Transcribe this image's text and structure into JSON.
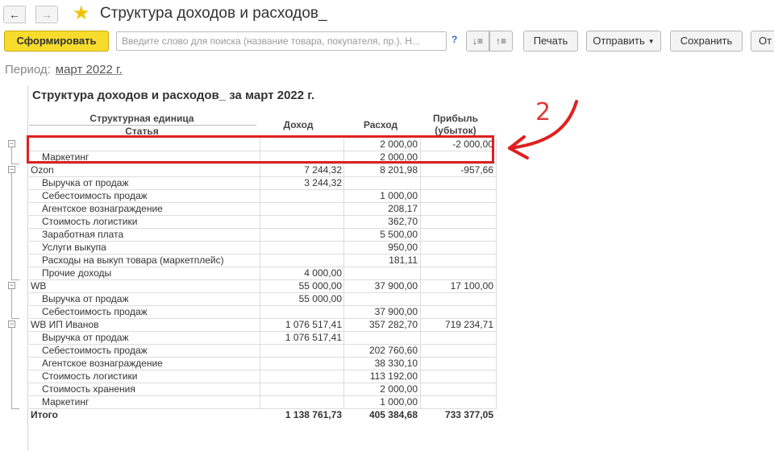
{
  "window": {
    "title": "Структура доходов и расходов_"
  },
  "toolbar": {
    "generate_label": "Сформировать",
    "search_placeholder": "Введите слово для поиска (название товара, покупателя, пр.). Н...",
    "help_label": "?",
    "print_label": "Печать",
    "send_label": "Отправить",
    "save_label": "Сохранить",
    "cut_label": "От"
  },
  "period": {
    "label": "Период:",
    "value": "март 2022 г."
  },
  "report": {
    "title": "Структура доходов и расходов_ за март 2022 г.",
    "headers": {
      "unit_line1": "Структурная единица",
      "unit_line2": "Статья",
      "income": "Доход",
      "expense": "Расход",
      "profit_line1": "Прибыль",
      "profit_line2": "(убыток)"
    },
    "rows": [
      {
        "name": "",
        "income": "",
        "expense": "2 000,00",
        "profit": "-2 000,00",
        "level": 0
      },
      {
        "name": "Маркетинг",
        "income": "",
        "expense": "2 000,00",
        "profit": "",
        "level": 1
      },
      {
        "name": "Ozon",
        "income": "7 244,32",
        "expense": "8 201,98",
        "profit": "-957,66",
        "level": 0
      },
      {
        "name": "Выручка от продаж",
        "income": "3 244,32",
        "expense": "",
        "profit": "",
        "level": 1
      },
      {
        "name": "Себестоимость продаж",
        "income": "",
        "expense": "1 000,00",
        "profit": "",
        "level": 1
      },
      {
        "name": "Агентское вознаграждение",
        "income": "",
        "expense": "208,17",
        "profit": "",
        "level": 1
      },
      {
        "name": "Стоимость логистики",
        "income": "",
        "expense": "362,70",
        "profit": "",
        "level": 1
      },
      {
        "name": "Заработная плата",
        "income": "",
        "expense": "5 500,00",
        "profit": "",
        "level": 1
      },
      {
        "name": "Услуги выкупа",
        "income": "",
        "expense": "950,00",
        "profit": "",
        "level": 1
      },
      {
        "name": "Расходы на выкуп товара (маркетплейс)",
        "income": "",
        "expense": "181,11",
        "profit": "",
        "level": 1
      },
      {
        "name": "Прочие доходы",
        "income": "4 000,00",
        "expense": "",
        "profit": "",
        "level": 1
      },
      {
        "name": "WB",
        "income": "55 000,00",
        "expense": "37 900,00",
        "profit": "17 100,00",
        "level": 0
      },
      {
        "name": "Выручка от продаж",
        "income": "55 000,00",
        "expense": "",
        "profit": "",
        "level": 1
      },
      {
        "name": "Себестоимость продаж",
        "income": "",
        "expense": "37 900,00",
        "profit": "",
        "level": 1
      },
      {
        "name": "WB ИП Иванов",
        "income": "1 076 517,41",
        "expense": "357 282,70",
        "profit": "719 234,71",
        "level": 0
      },
      {
        "name": "Выручка от продаж",
        "income": "1 076 517,41",
        "expense": "",
        "profit": "",
        "level": 1
      },
      {
        "name": "Себестоимость продаж",
        "income": "",
        "expense": "202 760,60",
        "profit": "",
        "level": 1
      },
      {
        "name": "Агентское вознаграждение",
        "income": "",
        "expense": "38 330,10",
        "profit": "",
        "level": 1
      },
      {
        "name": "Стоимость логистики",
        "income": "",
        "expense": "113 192,00",
        "profit": "",
        "level": 1
      },
      {
        "name": "Стоимость хранения",
        "income": "",
        "expense": "2 000,00",
        "profit": "",
        "level": 1
      },
      {
        "name": "Маркетинг",
        "income": "",
        "expense": "1 000,00",
        "profit": "",
        "level": 1
      }
    ],
    "total": {
      "name": "Итого",
      "income": "1 138 761,73",
      "expense": "405 384,68",
      "profit": "733 377,05"
    }
  },
  "annotation": {
    "number": "2",
    "color": "#e02020"
  }
}
